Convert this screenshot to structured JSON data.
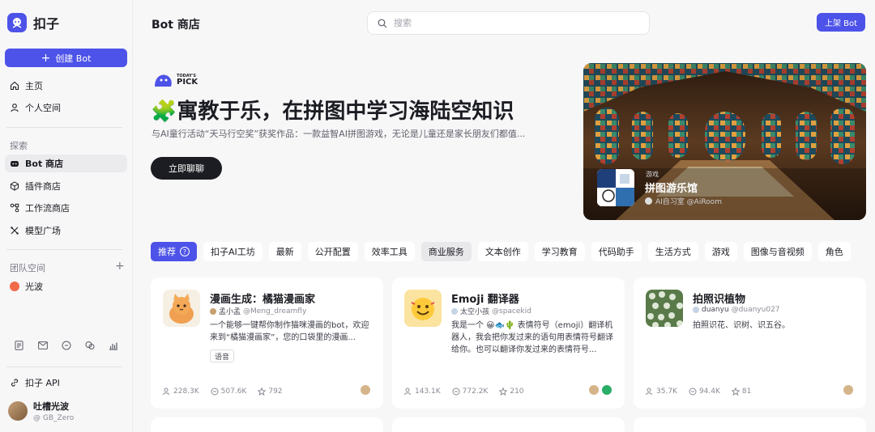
{
  "app": {
    "name": "扣子",
    "brand_color": "#4d53e8"
  },
  "sidebar": {
    "create_label": "创建 Bot",
    "nav_top": [
      {
        "label": "主页",
        "icon": "home-icon"
      },
      {
        "label": "个人空间",
        "icon": "user-icon"
      }
    ],
    "explore_label": "探索",
    "explore_items": [
      {
        "label": "Bot 商店",
        "icon": "bot-icon"
      },
      {
        "label": "插件商店",
        "icon": "cube-icon"
      },
      {
        "label": "工作流商店",
        "icon": "workflow-icon"
      },
      {
        "label": "模型广场",
        "icon": "model-icon"
      }
    ],
    "team_label": "团队空间",
    "team_items": [
      {
        "label": "光波",
        "icon": "team-avatar-icon"
      }
    ],
    "api_label": "扣子 API",
    "user": {
      "name": "吐槽光波",
      "handle": "@ GB_Zero"
    }
  },
  "header": {
    "title": "Bot 商店",
    "search_placeholder": "搜索",
    "publish_label": "上架 Bot"
  },
  "hero": {
    "badge_small": "TODAY'S",
    "badge_big": "PICK",
    "title": "🧩寓教于乐，在拼图中学习海陆空知识",
    "description": "与AI童行活动“天马行空奖”获奖作品：一款益智AI拼图游戏，无论是儿童还是家长朋友们都值...",
    "cta_label": "立即聊聊",
    "card": {
      "tag": "游戏",
      "title": "拼图游乐馆",
      "author": "AI自习室 @AiRoom"
    }
  },
  "tabs": [
    {
      "label": "推荐"
    },
    {
      "label": "扣子AI工坊"
    },
    {
      "label": "最新"
    },
    {
      "label": "公开配置"
    },
    {
      "label": "效率工具"
    },
    {
      "label": "商业服务"
    },
    {
      "label": "文本创作"
    },
    {
      "label": "学习教育"
    },
    {
      "label": "代码助手"
    },
    {
      "label": "生活方式"
    },
    {
      "label": "游戏"
    },
    {
      "label": "图像与音视频"
    },
    {
      "label": "角色"
    }
  ],
  "cards": [
    {
      "title": "漫画生成：橘猫漫画家",
      "author_name": "孟小孟",
      "author_handle": "@Meng_dreamfly",
      "description": "一个能够一键帮你制作猫咪漫画的bot，欢迎来到“橘猫漫画家”，您的口袋里的漫画...",
      "tag": "语音",
      "users": "228.3K",
      "chats": "507.6K",
      "stars": "792"
    },
    {
      "title": "Emoji 翻译器",
      "author_name": "太空小孩",
      "author_handle": "@spacekid",
      "description": "我是一个 😀🐟🌵 表情符号（emoji）翻译机器人，我会把你发过来的语句用表情符号翻译给你。也可以翻译你发过来的表情符号...",
      "tag": "",
      "users": "143.1K",
      "chats": "772.2K",
      "stars": "210"
    },
    {
      "title": "拍照识植物",
      "author_name": "duanyu",
      "author_handle": "@duanyu027",
      "description": "拍照识花、识树、识五谷。",
      "tag": "",
      "users": "35.7K",
      "chats": "94.4K",
      "stars": "81"
    }
  ]
}
